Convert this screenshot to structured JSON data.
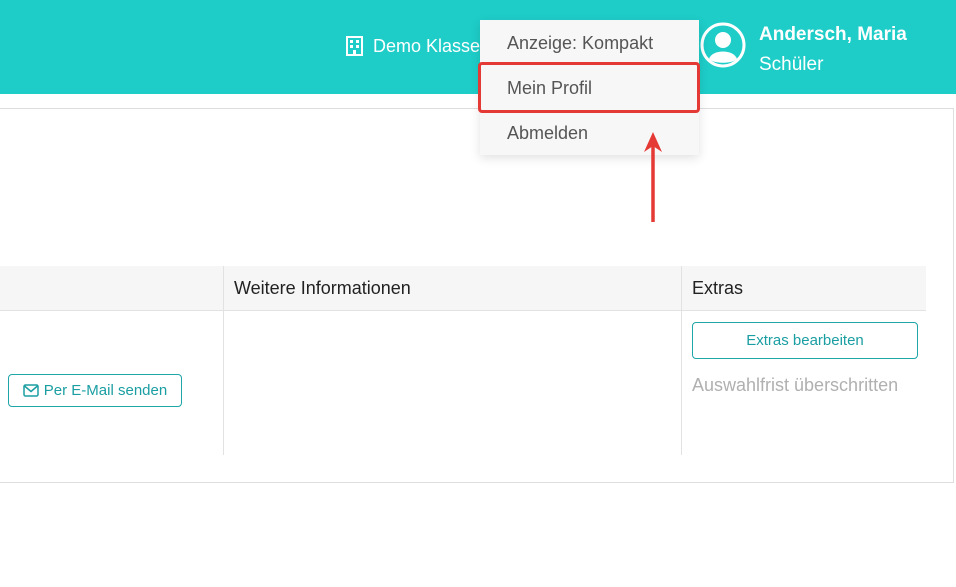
{
  "header": {
    "school_name": "Demo Klasse",
    "school_icon": "building-icon",
    "user": {
      "name": "Andersch, Maria",
      "role": "Schüler",
      "avatar_icon": "user-avatar-icon"
    }
  },
  "dropdown": {
    "items": [
      {
        "label": "Anzeige: Kompakt"
      },
      {
        "label": "Mein Profil",
        "highlighted": true
      },
      {
        "label": "Abmelden"
      }
    ]
  },
  "annotation": {
    "highlight_color": "#e53935",
    "arrow_icon": "up-arrow-icon"
  },
  "table": {
    "columns": [
      "Weitere Informationen",
      "Extras"
    ],
    "rows": [
      {
        "email_button_label": "Per E-Mail senden",
        "email_icon": "envelope-icon",
        "extras_button_label": "Extras bearbeiten",
        "extras_status": "Auswahlfrist überschritten"
      }
    ]
  },
  "colors": {
    "header_bg": "#1ecdc8",
    "accent": "#1a9ea2",
    "muted_text": "#b0b0b0"
  }
}
